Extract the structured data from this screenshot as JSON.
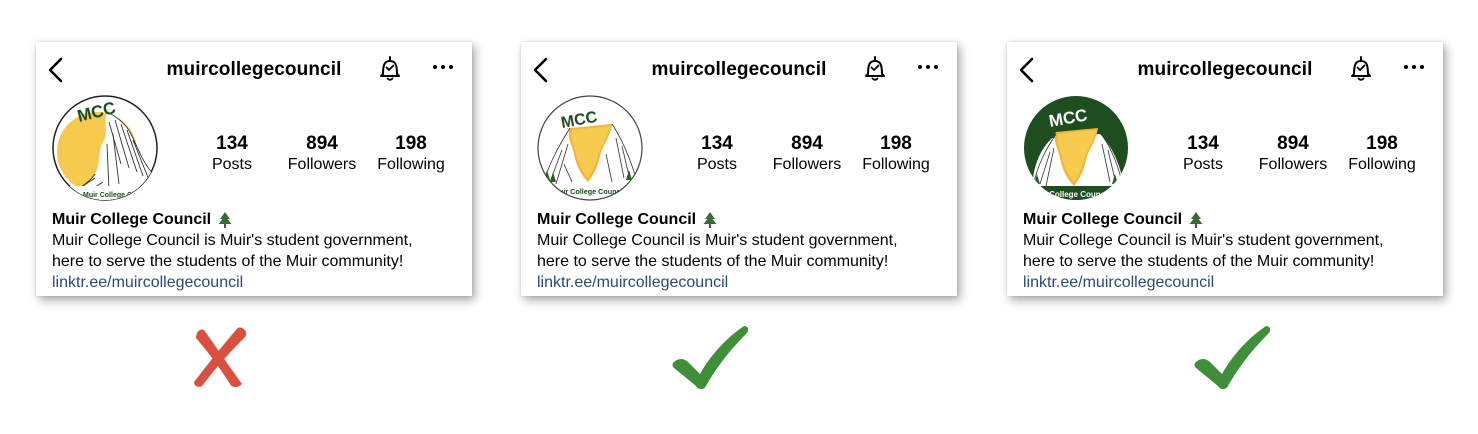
{
  "profiles": [
    {
      "handle": "muircollegecouncil",
      "avatar_logo_text": "MCC",
      "avatar_ring_text": "Muir College Council",
      "avatar_variant": "cropped",
      "stats": {
        "posts": "134",
        "posts_label": "Posts",
        "followers": "894",
        "followers_label": "Followers",
        "following": "198",
        "following_label": "Following"
      },
      "bio_name": "Muir College Council",
      "bio_line1": "Muir College Council is Muir's student government,",
      "bio_line2": "here to serve the students of the Muir community!",
      "link": "linktr.ee/muircollegecouncil",
      "verdict": "wrong"
    },
    {
      "handle": "muircollegecouncil",
      "avatar_logo_text": "MCC",
      "avatar_ring_text": "Muir College Council",
      "avatar_variant": "white",
      "stats": {
        "posts": "134",
        "posts_label": "Posts",
        "followers": "894",
        "followers_label": "Followers",
        "following": "198",
        "following_label": "Following"
      },
      "bio_name": "Muir College Council",
      "bio_line1": "Muir College Council is Muir's student government,",
      "bio_line2": "here to serve the students of the Muir community!",
      "link": "linktr.ee/muircollegecouncil",
      "verdict": "correct"
    },
    {
      "handle": "muircollegecouncil",
      "avatar_logo_text": "MCC",
      "avatar_ring_text": "Muir College Council",
      "avatar_variant": "green",
      "stats": {
        "posts": "134",
        "posts_label": "Posts",
        "followers": "894",
        "followers_label": "Followers",
        "following": "198",
        "following_label": "Following"
      },
      "bio_name": "Muir College Council",
      "bio_line1": "Muir College Council is Muir's student government,",
      "bio_line2": "here to serve the students of the Muir community!",
      "link": "linktr.ee/muircollegecouncil",
      "verdict": "correct"
    }
  ],
  "icons": [
    "back-arrow-icon",
    "notification-bell-icon",
    "more-options-icon",
    "pine-tree-icon",
    "red-x-icon",
    "green-checkmark-icon"
  ],
  "colors": {
    "wrong_mark": "#d9503f",
    "correct_mark": "#3f8f3a",
    "logo_green": "#1e4d1f",
    "sun_yellow": "#f2b63a",
    "link_blue": "#2a4a7a"
  }
}
